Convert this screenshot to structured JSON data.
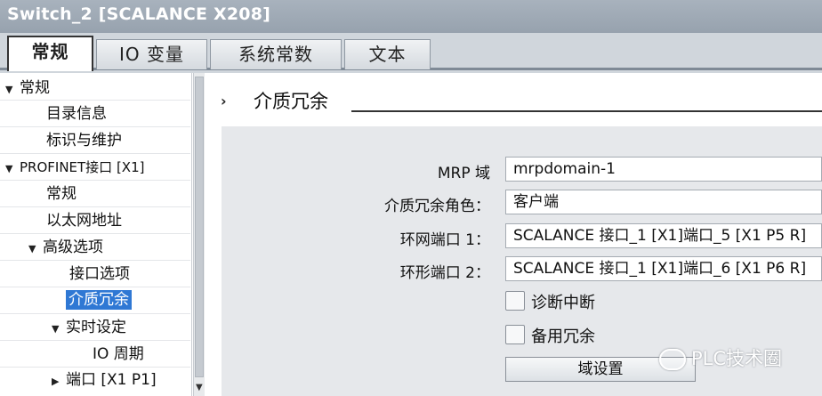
{
  "window": {
    "title": "Switch_2 [SCALANCE X208]"
  },
  "tabs": [
    {
      "label": "常规",
      "active": true
    },
    {
      "label": "IO 变量",
      "active": false
    },
    {
      "label": "系统常数",
      "active": false
    },
    {
      "label": "文本",
      "active": false
    }
  ],
  "nav": {
    "items": [
      {
        "label": "常规",
        "arrow": "▼"
      },
      {
        "label": "目录信息"
      },
      {
        "label": "标识与维护"
      },
      {
        "label": "PROFINET接口 [X1]",
        "arrow": "▼"
      },
      {
        "label": "常规"
      },
      {
        "label": "以太网地址"
      },
      {
        "label": "高级选项",
        "arrow": "▼"
      },
      {
        "label": "接口选项"
      },
      {
        "label": "介质冗余",
        "selected": true
      },
      {
        "label": "实时设定",
        "arrow": "▼"
      },
      {
        "label": "IO 周期"
      },
      {
        "label": "端口 [X1 P1]",
        "arrow": "▶"
      }
    ]
  },
  "section": {
    "arrow": "›",
    "title": "介质冗余"
  },
  "form": {
    "mrp_domain_label": "MRP 域",
    "mrp_domain_value": "mrpdomain-1",
    "role_label": "介质冗余角色：",
    "role_value": "客户端",
    "ring_port1_label": "环网端口 1：",
    "ring_port1_value": "SCALANCE 接口_1 [X1]端口_5 [X1 P5 R]",
    "ring_port2_label": "环形端口 2：",
    "ring_port2_value": "SCALANCE 接口_1 [X1]端口_6 [X1 P6 R]",
    "diag_interrupt_label": "诊断中断",
    "diag_interrupt_checked": false,
    "backup_redundancy_label": "备用冗余",
    "backup_redundancy_checked": false,
    "domain_settings_button": "域设置"
  },
  "watermark": {
    "text": "PLC技术圈"
  },
  "colors": {
    "selection": "#2f78d4",
    "titlebar": "#a0aab6",
    "panel": "#e6e8eb"
  }
}
